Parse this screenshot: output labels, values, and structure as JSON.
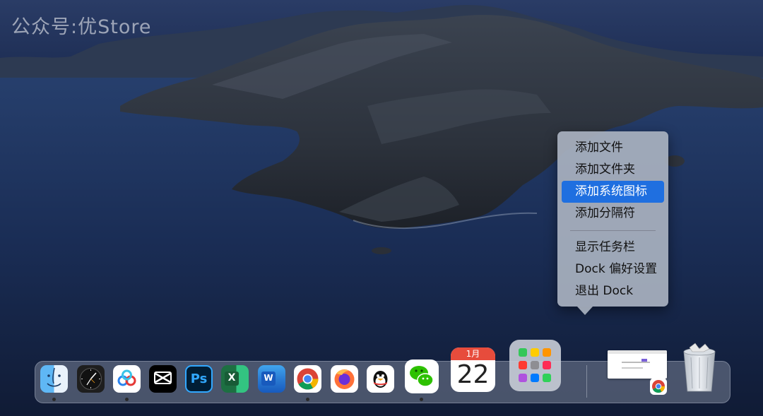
{
  "watermark": "公众号:优Store",
  "context_menu": {
    "items": [
      {
        "label": "添加文件"
      },
      {
        "label": "添加文件夹"
      },
      {
        "label": "添加系统图标"
      },
      {
        "label": "添加分隔符"
      }
    ],
    "items_secondary": [
      {
        "label": "显示任务栏"
      },
      {
        "label": "Dock 偏好设置"
      },
      {
        "label": "退出 Dock"
      }
    ],
    "highlighted_index": 2,
    "highlight_color": "#1f6fe0"
  },
  "dock": {
    "apps": [
      {
        "icon": "finder-icon",
        "running": true
      },
      {
        "icon": "clock-icon",
        "running": false
      },
      {
        "icon": "baidu-netdisk-icon",
        "running": true
      },
      {
        "icon": "capcut-icon",
        "running": false
      },
      {
        "icon": "photoshop-icon",
        "text": "Ps",
        "running": false
      },
      {
        "icon": "excel-icon",
        "text": "X",
        "running": false
      },
      {
        "icon": "word-icon",
        "text": "W",
        "running": false
      },
      {
        "icon": "chrome-icon",
        "running": true
      },
      {
        "icon": "firefox-icon",
        "running": false
      },
      {
        "icon": "qq-icon",
        "running": false
      },
      {
        "icon": "wechat-icon",
        "running": true
      },
      {
        "icon": "calendar-icon",
        "running": false
      },
      {
        "icon": "launchpad-icon",
        "running": false
      }
    ],
    "calendar": {
      "month": "1月",
      "day": "22"
    },
    "right_items": [
      {
        "icon": "chrome-window-thumbnail-icon"
      },
      {
        "icon": "trash-icon"
      }
    ]
  }
}
